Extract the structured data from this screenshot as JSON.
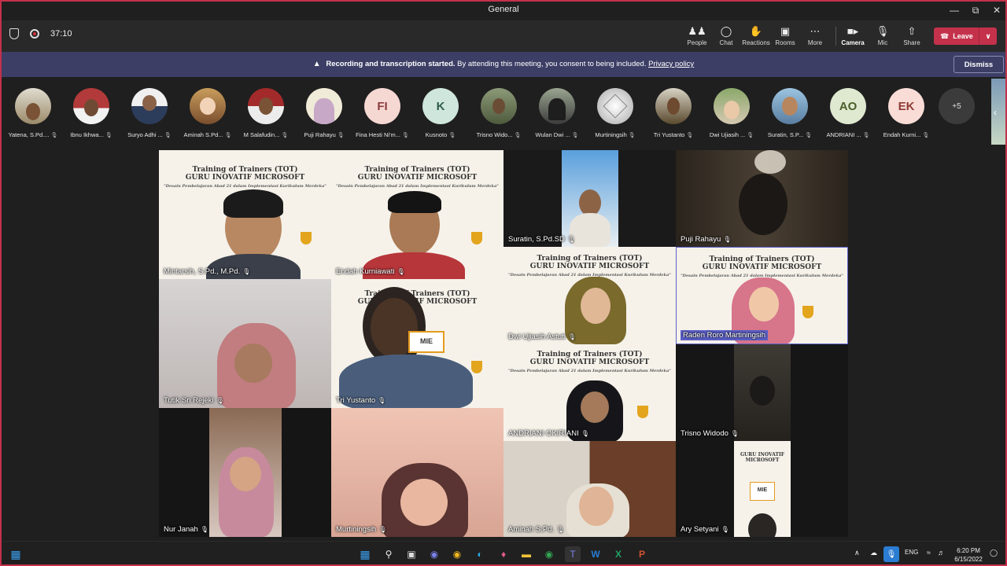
{
  "window": {
    "title": "General"
  },
  "toolbar": {
    "timer": "37:10",
    "buttons": [
      {
        "label": "People"
      },
      {
        "label": "Chat"
      },
      {
        "label": "Reactions"
      },
      {
        "label": "Rooms"
      },
      {
        "label": "More"
      },
      {
        "label": "Camera"
      },
      {
        "label": "Mic"
      },
      {
        "label": "Share"
      }
    ],
    "leave_label": "Leave"
  },
  "banner": {
    "strong_text": "Recording and transcription started.",
    "text": "By attending this meeting, you consent to being included.",
    "link": "Privacy policy",
    "dismiss_label": "Dismiss"
  },
  "participants": [
    {
      "name": "Yatena, S.Pd...."
    },
    {
      "name": "Ibnu Ikhwa..."
    },
    {
      "name": "Suryo Adhi ..."
    },
    {
      "name": "Aminah S.Pd..."
    },
    {
      "name": "M Salafudin..."
    },
    {
      "name": "Puji Rahayu"
    },
    {
      "name": "Fina Hesti Ni'm...",
      "initials": "FI"
    },
    {
      "name": "Kusnoto",
      "initials": "K"
    },
    {
      "name": "Trisno Wido..."
    },
    {
      "name": "Wulan Dwi ..."
    },
    {
      "name": "Murtiningsih"
    },
    {
      "name": "Tri Yustanto"
    },
    {
      "name": "Dwi Ujiasih ..."
    },
    {
      "name": "Suratin, S.P..."
    },
    {
      "name": "ANDRIANI ...",
      "initials": "AO"
    },
    {
      "name": "Endah Kurni...",
      "initials": "EK"
    }
  ],
  "more_count": "+5",
  "poster": {
    "line1": "Training of Trainers (TOT)",
    "line2": "GURU INOVATIF MICROSOFT",
    "line3": "\"Desain Pembelajaran Abad 21 dalam Implementasi Kurikulum Merdeka\""
  },
  "tiles": [
    {
      "name": "Mintarsih, S.Pd., M.Pd."
    },
    {
      "name": "Endah Kurniawati"
    },
    {
      "name": "Suratin, S.Pd.SD"
    },
    {
      "name": "Puji Rahayu"
    },
    {
      "name": "Dwi Ujiasih Astuti"
    },
    {
      "name": "Raden Roro Martiningsih"
    },
    {
      "name": "Tutik Sri Rejeki"
    },
    {
      "name": "Tri Yustanto"
    },
    {
      "name": "ANDRIANI OKIRIANI"
    },
    {
      "name": "Trisno Widodo"
    },
    {
      "name": "Nur Janah"
    },
    {
      "name": "Murtiningsih"
    },
    {
      "name": "Aminah S.Pd."
    },
    {
      "name": "Ary Setyani"
    }
  ],
  "taskbar": {
    "lang": "ENG",
    "time": "6:20 PM",
    "date": "6/15/2022"
  },
  "colors": {
    "accent": "#5b5fc7",
    "leave": "#c4314b",
    "banner": "#3d3e66"
  }
}
